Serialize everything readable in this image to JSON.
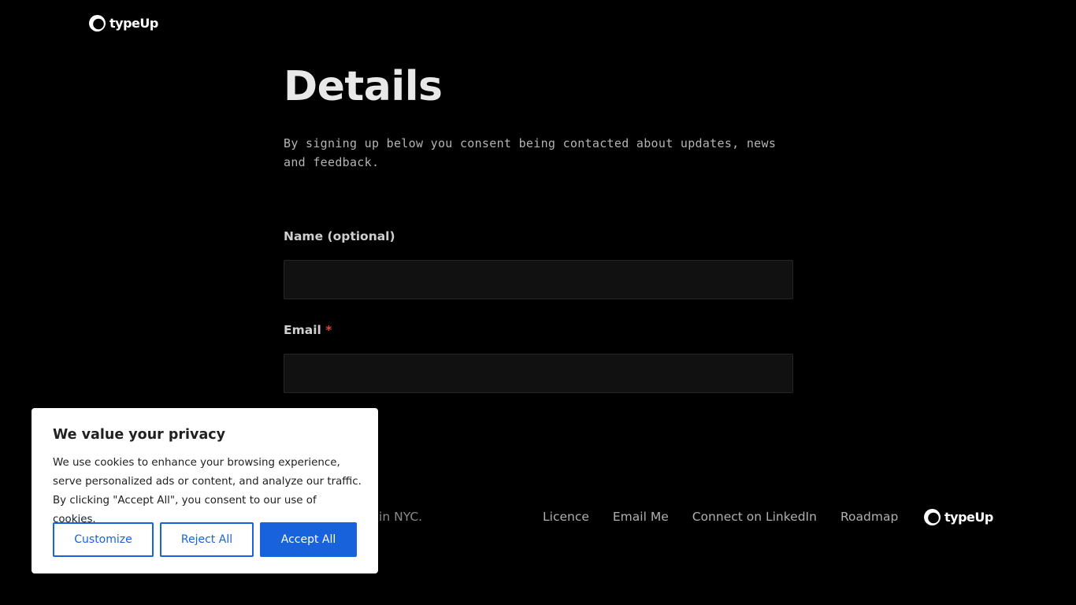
{
  "header": {
    "logo_text": "typeUp"
  },
  "main": {
    "title": "Details",
    "subtitle": "By signing up below you consent being contacted about updates, news and feedback.",
    "name_field": {
      "label": "Name (optional)",
      "value": "",
      "placeholder": ""
    },
    "email_field": {
      "label": "Email",
      "required_marker": "*",
      "value": "",
      "placeholder": ""
    }
  },
  "footer": {
    "credit": "ade by @davis in NYC.",
    "links": [
      "Licence",
      "Email Me",
      "Connect on LinkedIn",
      "Roadmap"
    ],
    "logo_text": "typeUp"
  },
  "cookie_banner": {
    "title": "We value your privacy",
    "body": "We use cookies to enhance your browsing experience, serve personalized ads or content, and analyze our traffic. By clicking \"Accept All\", you consent to our use of cookies.",
    "customize_label": "Customize",
    "reject_label": "Reject All",
    "accept_label": "Accept All"
  },
  "colors": {
    "background": "#000000",
    "accent": "#1863dc",
    "required": "#e0443a",
    "input_bg": "#111111"
  },
  "icons": {
    "logo": "typeup-logo-icon"
  }
}
